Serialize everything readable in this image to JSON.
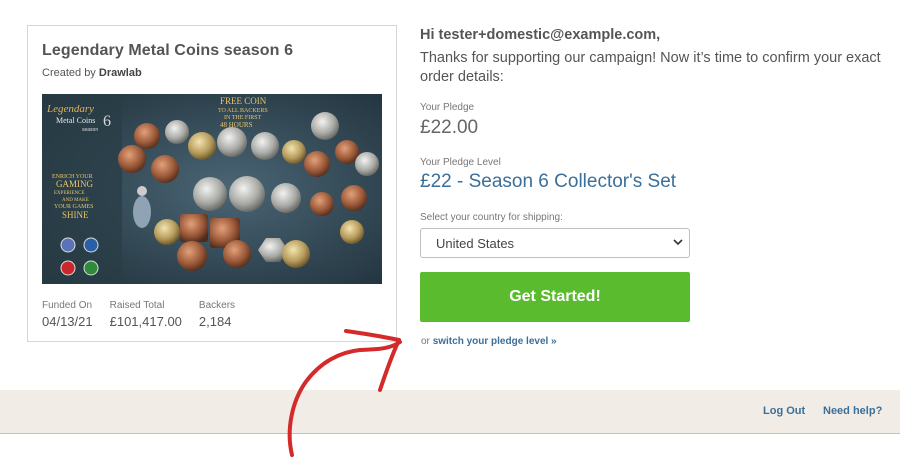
{
  "campaign": {
    "title": "Legendary Metal Coins season 6",
    "created_by_prefix": "Created by",
    "creator": "Drawlab",
    "image": {
      "brand_line1": "Legendary",
      "brand_line2": "Metal Coins",
      "brand_number": "6",
      "brand_season": "season",
      "promo_line1": "FREE COIN",
      "promo_line2": "TO ALL BACKERS",
      "promo_line3": "IN THE FIRST",
      "promo_line4": "48 HOURS",
      "side_line1": "ENRICH YOUR",
      "side_line2": "GAMING",
      "side_line3": "EXPERIENCE",
      "side_line4": "AND MAKE",
      "side_line5": "YOUR GAMES",
      "side_line6": "SHINE"
    },
    "stats": [
      {
        "label": "Funded On",
        "value": "04/13/21"
      },
      {
        "label": "Raised Total",
        "value": "£101,417.00"
      },
      {
        "label": "Backers",
        "value": "2,184"
      }
    ]
  },
  "checkout": {
    "greeting": "Hi tester+domestic@example.com,",
    "intro": "Thanks for supporting our campaign! Now it’s time to confirm your exact order details:",
    "pledge_label": "Your Pledge",
    "pledge_amount": "£22.00",
    "level_label": "Your Pledge Level",
    "level_value": "£22 - Season 6 Collector's Set",
    "country_label": "Select your country for shipping:",
    "country_selected": "United States",
    "start_button": "Get Started!",
    "switch_prefix": "or",
    "switch_link": "switch your pledge level »"
  },
  "footer": {
    "logout": "Log Out",
    "help": "Need help?"
  },
  "colors": {
    "accent_green": "#5bbb2f",
    "link_blue": "#3a6f9a",
    "footer_bg": "#f1ede6",
    "annotation_red": "#d42a2a"
  }
}
